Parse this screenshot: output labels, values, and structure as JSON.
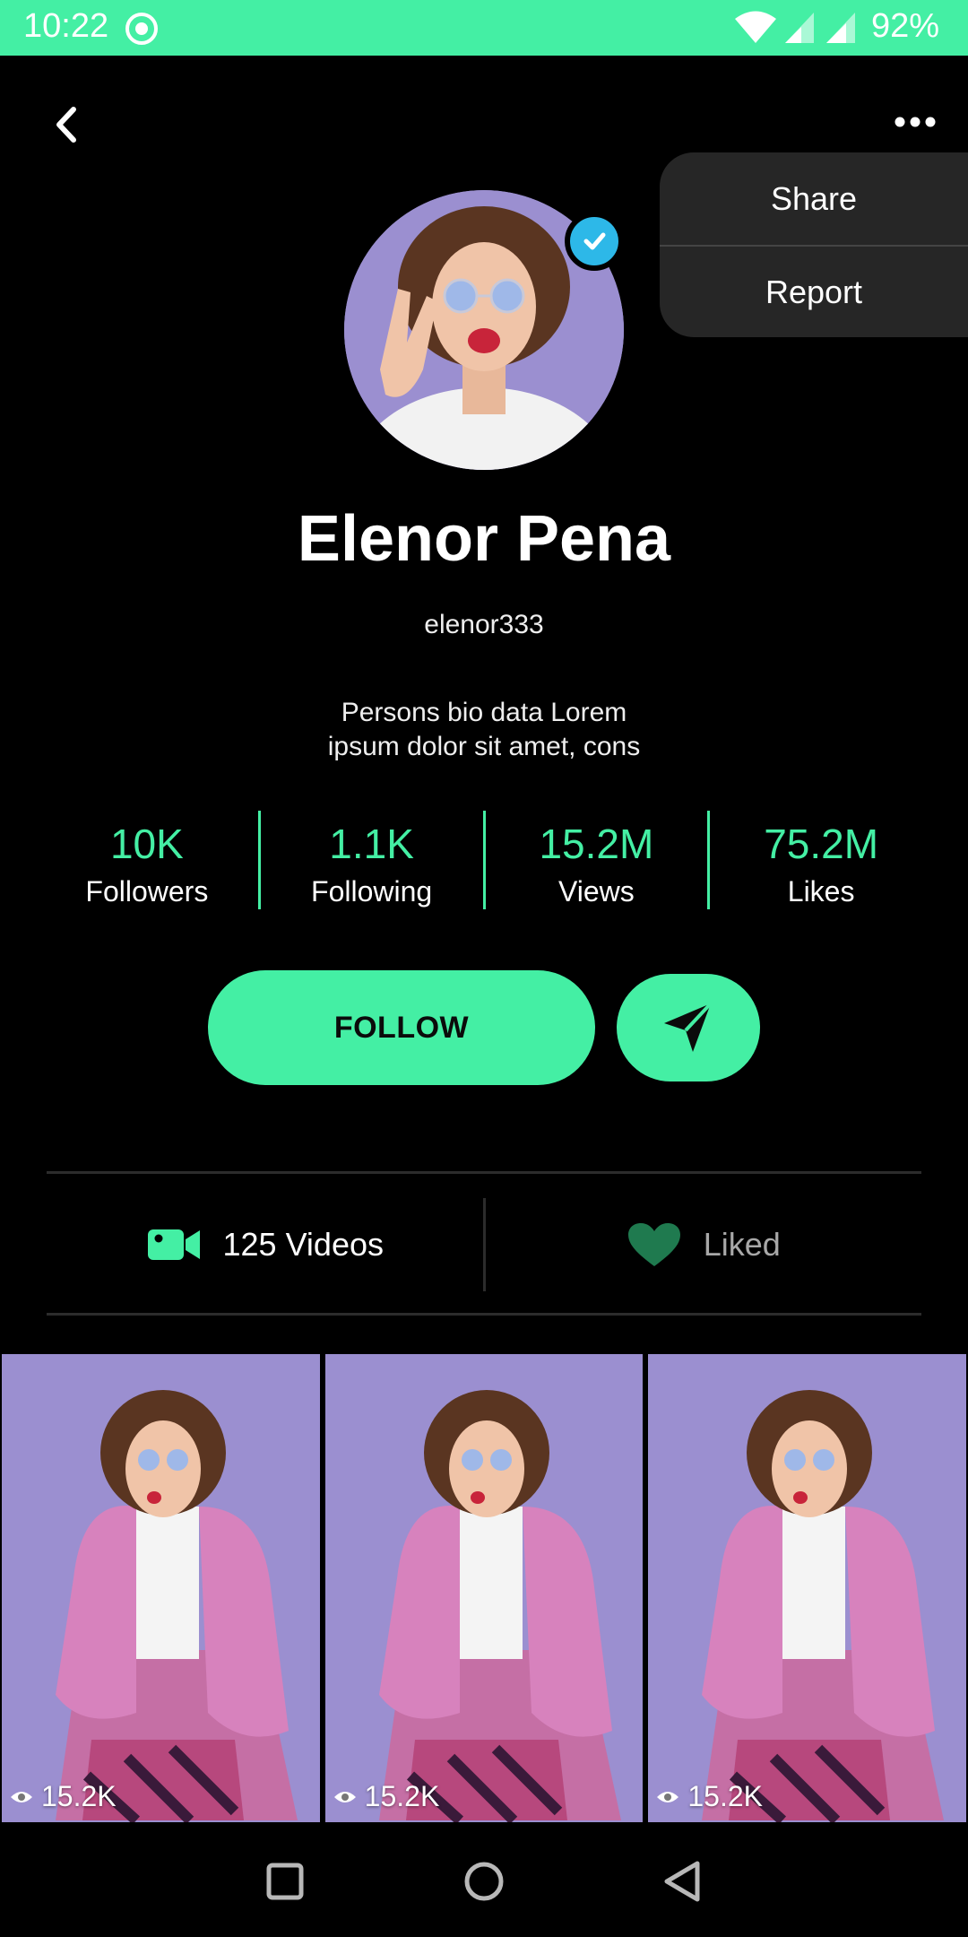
{
  "status_bar": {
    "time": "10:22",
    "battery": "92%"
  },
  "menu": {
    "items": [
      {
        "label": "Share"
      },
      {
        "label": "Report"
      }
    ]
  },
  "profile": {
    "name": "Elenor Pena",
    "username": "elenor333",
    "bio_line1": "Persons bio data  Lorem",
    "bio_line2": "ipsum dolor sit amet, cons",
    "verified": true
  },
  "stats": [
    {
      "value": "10K",
      "label": "Followers"
    },
    {
      "value": "1.1K",
      "label": "Following"
    },
    {
      "value": "15.2M",
      "label": "Views"
    },
    {
      "value": "75.2M",
      "label": "Likes"
    }
  ],
  "actions": {
    "follow_label": "FOLLOW"
  },
  "tabs": [
    {
      "label": "125 Videos",
      "icon": "video-camera-icon",
      "active": true
    },
    {
      "label": "Liked",
      "icon": "heart-icon",
      "active": false
    }
  ],
  "videos": [
    {
      "views": "15.2K"
    },
    {
      "views": "15.2K"
    },
    {
      "views": "15.2K"
    }
  ],
  "colors": {
    "accent": "#44efa4",
    "background": "#000000",
    "menu_bg": "#262626",
    "verified": "#2db8e8",
    "thumb_bg": "#9b8fd0"
  }
}
